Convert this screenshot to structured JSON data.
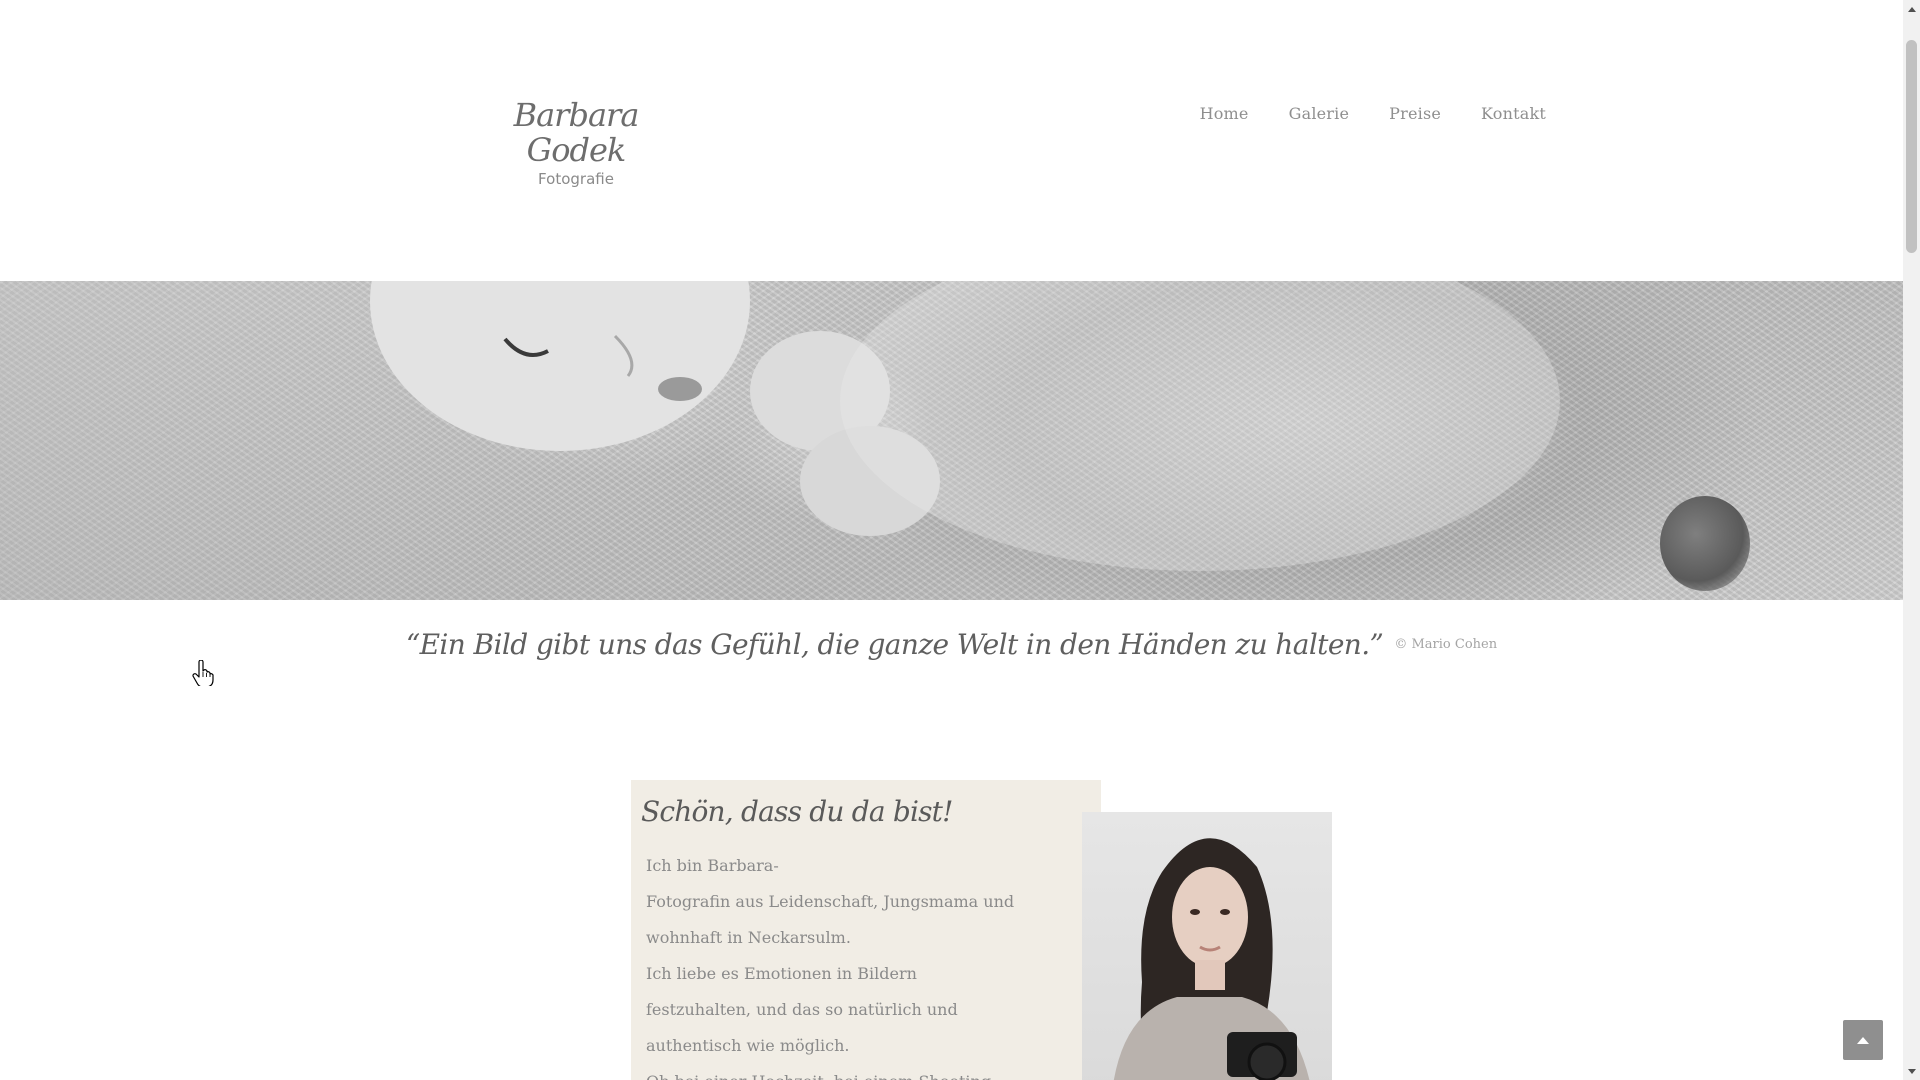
{
  "site": {
    "logo_name": "Barbara Godek",
    "logo_subtitle": "Fotografie"
  },
  "nav": {
    "items": [
      {
        "label": "Home"
      },
      {
        "label": "Galerie"
      },
      {
        "label": "Preise"
      },
      {
        "label": "Kontakt"
      }
    ]
  },
  "quote": {
    "text": "“Ein Bild gibt uns das Gefühl, die ganze Welt in den Händen zu halten.”",
    "credit": "© Mario Cohen"
  },
  "welcome": {
    "title": "Schön, dass du da bist!",
    "paragraphs": [
      "Ich bin Barbara-",
      "Fotografin aus Leidenschaft,  Jungsmama und wohnhaft in Neckarsulm.",
      "Ich liebe es Emotionen in Bildern festzuhalten, und das so natürlich und authentisch wie möglich.",
      "Ob bei einer Hochzeit, bei einem Shooting"
    ]
  },
  "colors": {
    "welcome_background": "#f1ede5",
    "text_gray": "#8a8a8a",
    "to_top_button": "#8f8f8f"
  },
  "icons": {
    "to_top": "chevron-up-icon",
    "cursor": "hand-pointer-icon"
  }
}
